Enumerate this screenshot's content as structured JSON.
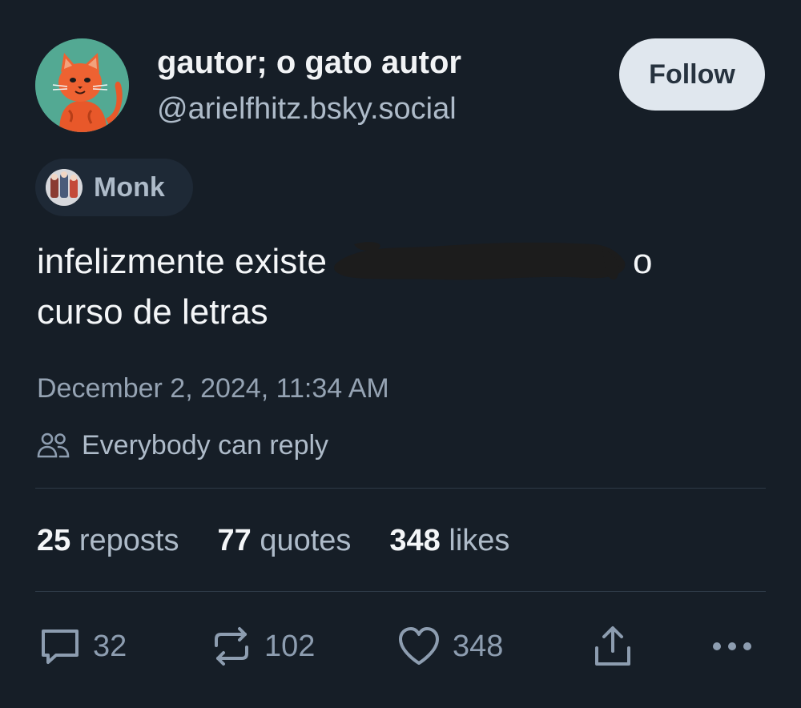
{
  "author": {
    "display_name": "gautor; o gato autor",
    "handle": "@arielfhitz.bsky.social",
    "avatar_icon": "orange-cat-avatar"
  },
  "follow_button": {
    "label": "Follow"
  },
  "label_chip": {
    "text": "Monk",
    "avatar_icon": "monk-label-avatar"
  },
  "post": {
    "text_before": "infelizmente existe",
    "text_redacted": "[redacted]",
    "text_after": "o",
    "line2": "curso de letras",
    "timestamp": "December 2, 2024, 11:34 AM"
  },
  "reply_setting": {
    "text": "Everybody can reply",
    "icon": "people-icon"
  },
  "stats": {
    "reposts": {
      "count": "25",
      "label": "reposts"
    },
    "quotes": {
      "count": "77",
      "label": "quotes"
    },
    "likes": {
      "count": "348",
      "label": "likes"
    }
  },
  "actions": {
    "reply": {
      "icon": "reply-bubble-icon",
      "count": "32"
    },
    "repost": {
      "icon": "repost-arrows-icon",
      "count": "102"
    },
    "like": {
      "icon": "heart-icon",
      "count": "348"
    },
    "share": {
      "icon": "share-upload-icon"
    },
    "more": {
      "icon": "more-horizontal-icon"
    }
  },
  "colors": {
    "background": "#161e27",
    "text_primary": "#f1f3f5",
    "text_secondary": "#aebbc9",
    "follow_bg": "#e0e7ee",
    "chip_bg": "#1e2936"
  }
}
